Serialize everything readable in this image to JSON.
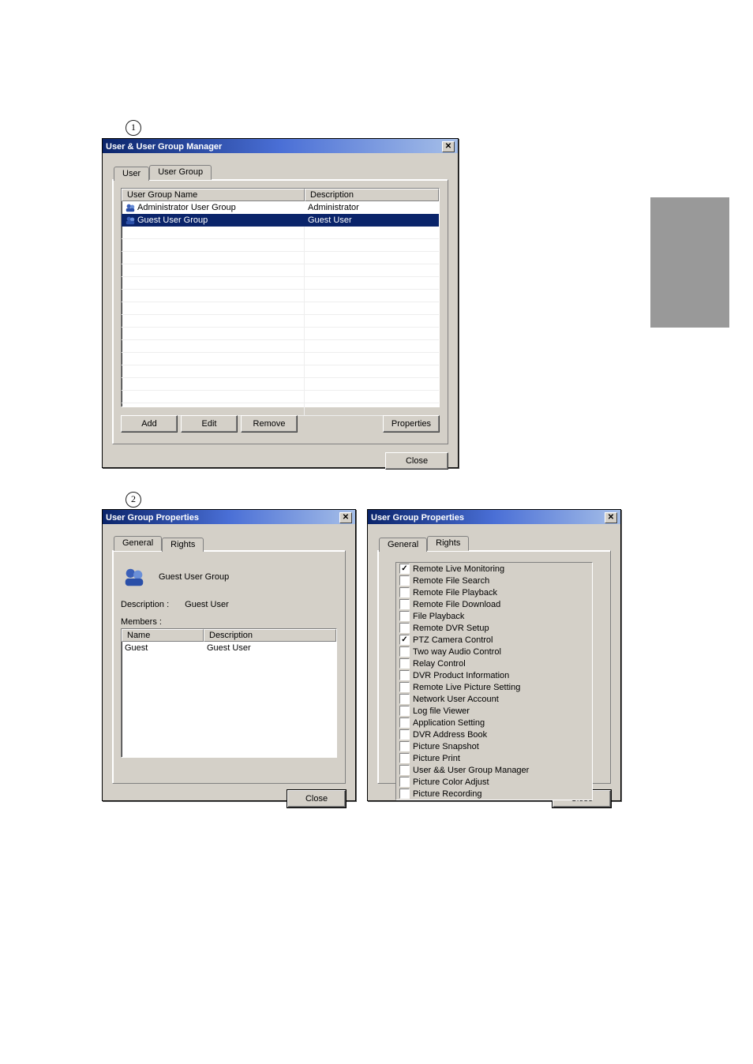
{
  "callouts": {
    "c1": "1",
    "c2": "2"
  },
  "manager": {
    "title": "User & User Group Manager",
    "tabs": {
      "user": "User",
      "userGroup": "User Group"
    },
    "list": {
      "headers": {
        "name": "User Group Name",
        "desc": "Description"
      },
      "rows": [
        {
          "name": "Administrator User Group",
          "desc": "Administrator",
          "selected": false
        },
        {
          "name": "Guest User Group",
          "desc": "Guest User",
          "selected": true
        }
      ]
    },
    "buttons": {
      "add": "Add",
      "edit": "Edit",
      "remove": "Remove",
      "properties": "Properties",
      "close": "Close"
    }
  },
  "propsGeneral": {
    "title": "User Group Properties",
    "tabs": {
      "general": "General",
      "rights": "Rights"
    },
    "groupName": "Guest User Group",
    "descriptionLabel": "Description :",
    "descriptionValue": "Guest User",
    "membersLabel": "Members :",
    "membersTable": {
      "headers": {
        "name": "Name",
        "desc": "Description"
      },
      "rows": [
        {
          "name": "Guest",
          "desc": "Guest User"
        }
      ]
    },
    "close": "Close"
  },
  "propsRights": {
    "title": "User Group Properties",
    "tabs": {
      "general": "General",
      "rights": "Rights"
    },
    "items": [
      {
        "label": "Remote Live Monitoring",
        "checked": true
      },
      {
        "label": "Remote File Search",
        "checked": false
      },
      {
        "label": "Remote File Playback",
        "checked": false
      },
      {
        "label": "Remote File Download",
        "checked": false
      },
      {
        "label": "File Playback",
        "checked": false
      },
      {
        "label": "Remote DVR Setup",
        "checked": false
      },
      {
        "label": "PTZ Camera Control",
        "checked": true
      },
      {
        "label": "Two way Audio Control",
        "checked": false
      },
      {
        "label": "Relay Control",
        "checked": false
      },
      {
        "label": "DVR Product Information",
        "checked": false
      },
      {
        "label": "Remote Live Picture Setting",
        "checked": false
      },
      {
        "label": "Network User Account",
        "checked": false
      },
      {
        "label": "Log file Viewer",
        "checked": false
      },
      {
        "label": "Application Setting",
        "checked": false
      },
      {
        "label": "DVR Address Book",
        "checked": false
      },
      {
        "label": "Picture Snapshot",
        "checked": false
      },
      {
        "label": "Picture Print",
        "checked": false
      },
      {
        "label": "User && User Group Manager",
        "checked": false
      },
      {
        "label": "Picture Color Adjust",
        "checked": false
      },
      {
        "label": "Picture Recording",
        "checked": false
      }
    ],
    "close": "Close"
  }
}
